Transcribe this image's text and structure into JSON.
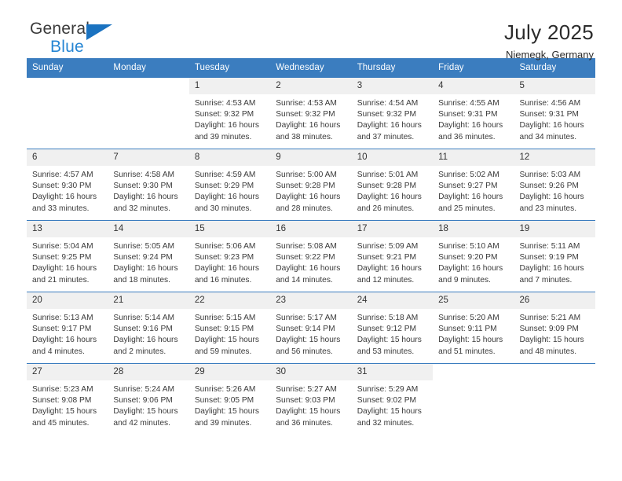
{
  "brand": {
    "name_part1": "General",
    "name_part2": "Blue",
    "triangle_color": "#1a72c0",
    "blue_color": "#2585d3"
  },
  "header": {
    "title": "July 2025",
    "subtitle": "Niemegk, Germany",
    "accent_color": "#3b7dbf"
  },
  "calendar": {
    "weekday_headers": [
      "Sunday",
      "Monday",
      "Tuesday",
      "Wednesday",
      "Thursday",
      "Friday",
      "Saturday"
    ],
    "labels": {
      "sunrise": "Sunrise:",
      "sunset": "Sunset:",
      "daylight": "Daylight:"
    },
    "weeks": [
      [
        {
          "day": "",
          "blank": true
        },
        {
          "day": "",
          "blank": true
        },
        {
          "day": "1",
          "sunrise": "Sunrise: 4:53 AM",
          "sunset": "Sunset: 9:32 PM",
          "daylight1": "Daylight: 16 hours",
          "daylight2": "and 39 minutes."
        },
        {
          "day": "2",
          "sunrise": "Sunrise: 4:53 AM",
          "sunset": "Sunset: 9:32 PM",
          "daylight1": "Daylight: 16 hours",
          "daylight2": "and 38 minutes."
        },
        {
          "day": "3",
          "sunrise": "Sunrise: 4:54 AM",
          "sunset": "Sunset: 9:32 PM",
          "daylight1": "Daylight: 16 hours",
          "daylight2": "and 37 minutes."
        },
        {
          "day": "4",
          "sunrise": "Sunrise: 4:55 AM",
          "sunset": "Sunset: 9:31 PM",
          "daylight1": "Daylight: 16 hours",
          "daylight2": "and 36 minutes."
        },
        {
          "day": "5",
          "sunrise": "Sunrise: 4:56 AM",
          "sunset": "Sunset: 9:31 PM",
          "daylight1": "Daylight: 16 hours",
          "daylight2": "and 34 minutes."
        }
      ],
      [
        {
          "day": "6",
          "sunrise": "Sunrise: 4:57 AM",
          "sunset": "Sunset: 9:30 PM",
          "daylight1": "Daylight: 16 hours",
          "daylight2": "and 33 minutes."
        },
        {
          "day": "7",
          "sunrise": "Sunrise: 4:58 AM",
          "sunset": "Sunset: 9:30 PM",
          "daylight1": "Daylight: 16 hours",
          "daylight2": "and 32 minutes."
        },
        {
          "day": "8",
          "sunrise": "Sunrise: 4:59 AM",
          "sunset": "Sunset: 9:29 PM",
          "daylight1": "Daylight: 16 hours",
          "daylight2": "and 30 minutes."
        },
        {
          "day": "9",
          "sunrise": "Sunrise: 5:00 AM",
          "sunset": "Sunset: 9:28 PM",
          "daylight1": "Daylight: 16 hours",
          "daylight2": "and 28 minutes."
        },
        {
          "day": "10",
          "sunrise": "Sunrise: 5:01 AM",
          "sunset": "Sunset: 9:28 PM",
          "daylight1": "Daylight: 16 hours",
          "daylight2": "and 26 minutes."
        },
        {
          "day": "11",
          "sunrise": "Sunrise: 5:02 AM",
          "sunset": "Sunset: 9:27 PM",
          "daylight1": "Daylight: 16 hours",
          "daylight2": "and 25 minutes."
        },
        {
          "day": "12",
          "sunrise": "Sunrise: 5:03 AM",
          "sunset": "Sunset: 9:26 PM",
          "daylight1": "Daylight: 16 hours",
          "daylight2": "and 23 minutes."
        }
      ],
      [
        {
          "day": "13",
          "sunrise": "Sunrise: 5:04 AM",
          "sunset": "Sunset: 9:25 PM",
          "daylight1": "Daylight: 16 hours",
          "daylight2": "and 21 minutes."
        },
        {
          "day": "14",
          "sunrise": "Sunrise: 5:05 AM",
          "sunset": "Sunset: 9:24 PM",
          "daylight1": "Daylight: 16 hours",
          "daylight2": "and 18 minutes."
        },
        {
          "day": "15",
          "sunrise": "Sunrise: 5:06 AM",
          "sunset": "Sunset: 9:23 PM",
          "daylight1": "Daylight: 16 hours",
          "daylight2": "and 16 minutes."
        },
        {
          "day": "16",
          "sunrise": "Sunrise: 5:08 AM",
          "sunset": "Sunset: 9:22 PM",
          "daylight1": "Daylight: 16 hours",
          "daylight2": "and 14 minutes."
        },
        {
          "day": "17",
          "sunrise": "Sunrise: 5:09 AM",
          "sunset": "Sunset: 9:21 PM",
          "daylight1": "Daylight: 16 hours",
          "daylight2": "and 12 minutes."
        },
        {
          "day": "18",
          "sunrise": "Sunrise: 5:10 AM",
          "sunset": "Sunset: 9:20 PM",
          "daylight1": "Daylight: 16 hours",
          "daylight2": "and 9 minutes."
        },
        {
          "day": "19",
          "sunrise": "Sunrise: 5:11 AM",
          "sunset": "Sunset: 9:19 PM",
          "daylight1": "Daylight: 16 hours",
          "daylight2": "and 7 minutes."
        }
      ],
      [
        {
          "day": "20",
          "sunrise": "Sunrise: 5:13 AM",
          "sunset": "Sunset: 9:17 PM",
          "daylight1": "Daylight: 16 hours",
          "daylight2": "and 4 minutes."
        },
        {
          "day": "21",
          "sunrise": "Sunrise: 5:14 AM",
          "sunset": "Sunset: 9:16 PM",
          "daylight1": "Daylight: 16 hours",
          "daylight2": "and 2 minutes."
        },
        {
          "day": "22",
          "sunrise": "Sunrise: 5:15 AM",
          "sunset": "Sunset: 9:15 PM",
          "daylight1": "Daylight: 15 hours",
          "daylight2": "and 59 minutes."
        },
        {
          "day": "23",
          "sunrise": "Sunrise: 5:17 AM",
          "sunset": "Sunset: 9:14 PM",
          "daylight1": "Daylight: 15 hours",
          "daylight2": "and 56 minutes."
        },
        {
          "day": "24",
          "sunrise": "Sunrise: 5:18 AM",
          "sunset": "Sunset: 9:12 PM",
          "daylight1": "Daylight: 15 hours",
          "daylight2": "and 53 minutes."
        },
        {
          "day": "25",
          "sunrise": "Sunrise: 5:20 AM",
          "sunset": "Sunset: 9:11 PM",
          "daylight1": "Daylight: 15 hours",
          "daylight2": "and 51 minutes."
        },
        {
          "day": "26",
          "sunrise": "Sunrise: 5:21 AM",
          "sunset": "Sunset: 9:09 PM",
          "daylight1": "Daylight: 15 hours",
          "daylight2": "and 48 minutes."
        }
      ],
      [
        {
          "day": "27",
          "sunrise": "Sunrise: 5:23 AM",
          "sunset": "Sunset: 9:08 PM",
          "daylight1": "Daylight: 15 hours",
          "daylight2": "and 45 minutes."
        },
        {
          "day": "28",
          "sunrise": "Sunrise: 5:24 AM",
          "sunset": "Sunset: 9:06 PM",
          "daylight1": "Daylight: 15 hours",
          "daylight2": "and 42 minutes."
        },
        {
          "day": "29",
          "sunrise": "Sunrise: 5:26 AM",
          "sunset": "Sunset: 9:05 PM",
          "daylight1": "Daylight: 15 hours",
          "daylight2": "and 39 minutes."
        },
        {
          "day": "30",
          "sunrise": "Sunrise: 5:27 AM",
          "sunset": "Sunset: 9:03 PM",
          "daylight1": "Daylight: 15 hours",
          "daylight2": "and 36 minutes."
        },
        {
          "day": "31",
          "sunrise": "Sunrise: 5:29 AM",
          "sunset": "Sunset: 9:02 PM",
          "daylight1": "Daylight: 15 hours",
          "daylight2": "and 32 minutes."
        },
        {
          "day": "",
          "blank": true
        },
        {
          "day": "",
          "blank": true
        }
      ]
    ]
  }
}
